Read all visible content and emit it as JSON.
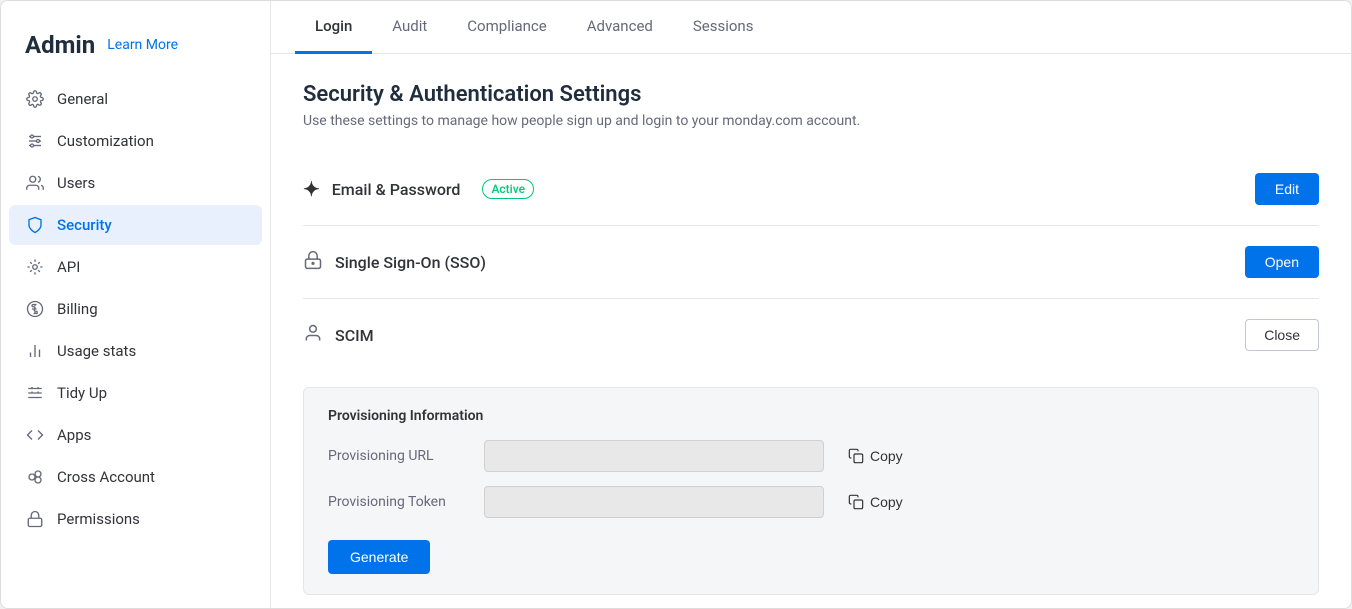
{
  "sidebar": {
    "title": "Admin",
    "learn_more": "Learn More",
    "items": [
      {
        "id": "general",
        "label": "General",
        "icon": "⚙"
      },
      {
        "id": "customization",
        "label": "Customization",
        "icon": "⇌"
      },
      {
        "id": "users",
        "label": "Users",
        "icon": "👤"
      },
      {
        "id": "security",
        "label": "Security",
        "icon": "🛡"
      },
      {
        "id": "api",
        "label": "API",
        "icon": "⚡"
      },
      {
        "id": "billing",
        "label": "Billing",
        "icon": "$"
      },
      {
        "id": "usage-stats",
        "label": "Usage stats",
        "icon": "📊"
      },
      {
        "id": "tidy-up",
        "label": "Tidy Up",
        "icon": "🧹"
      },
      {
        "id": "apps",
        "label": "Apps",
        "icon": "</>"
      },
      {
        "id": "cross-account",
        "label": "Cross Account",
        "icon": "⚡"
      },
      {
        "id": "permissions",
        "label": "Permissions",
        "icon": "🔒"
      }
    ]
  },
  "tabs": [
    {
      "id": "login",
      "label": "Login",
      "active": true
    },
    {
      "id": "audit",
      "label": "Audit"
    },
    {
      "id": "compliance",
      "label": "Compliance"
    },
    {
      "id": "advanced",
      "label": "Advanced"
    },
    {
      "id": "sessions",
      "label": "Sessions"
    }
  ],
  "page": {
    "title": "Security & Authentication Settings",
    "subtitle": "Use these settings to manage how people sign up and login to your monday.com account."
  },
  "sections": [
    {
      "id": "email-password",
      "icon": "✦",
      "title": "Email & Password",
      "badge": "Active",
      "button": "Edit",
      "button_type": "primary"
    },
    {
      "id": "sso",
      "icon": "🔐",
      "title": "Single Sign-On (SSO)",
      "badge": null,
      "button": "Open",
      "button_type": "primary"
    },
    {
      "id": "scim",
      "icon": "👤",
      "title": "SCIM",
      "badge": null,
      "button": "Close",
      "button_type": "outline"
    }
  ],
  "scim": {
    "panel_title": "Provisioning Information",
    "url_label": "Provisioning URL",
    "url_placeholder": "",
    "url_copy": "Copy",
    "token_label": "Provisioning Token",
    "token_placeholder": "",
    "token_copy": "Copy",
    "generate_btn": "Generate"
  }
}
